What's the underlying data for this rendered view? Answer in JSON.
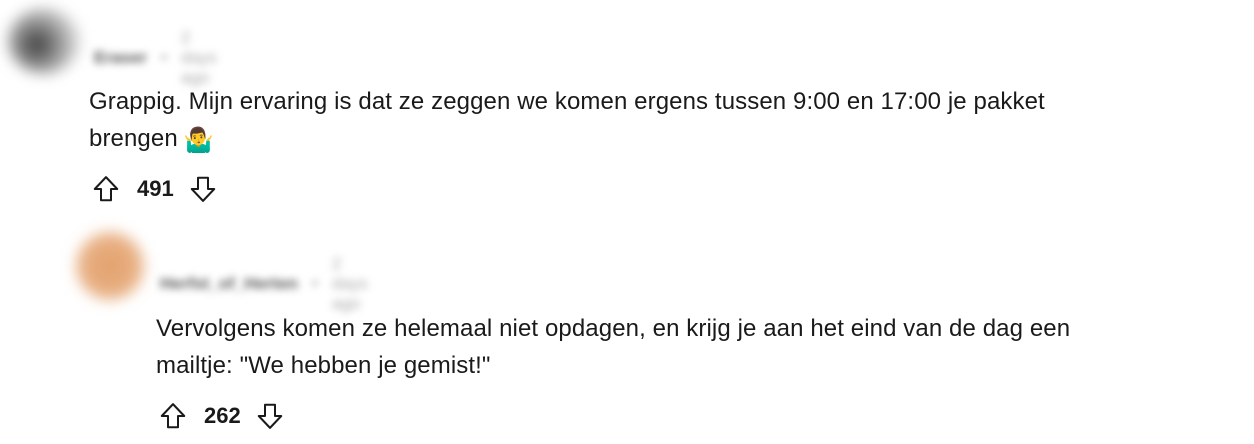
{
  "comments": [
    {
      "username": "Eraser",
      "time": "2 days ago",
      "text_lines": [
        "Grappig. Mijn ervaring is dat ze zeggen we komen ergens tussen 9:00 en 17:00 je pakket",
        "brengen"
      ],
      "emoji": "🤷‍♂️",
      "score": "491"
    },
    {
      "username": "Herfst_of_Herten",
      "time": "2 days ago",
      "text_lines": [
        "Vervolgens komen ze helemaal niet opdagen, en krijg je aan het eind van de dag een",
        "mailtje: \"We hebben je gemist!\""
      ],
      "score": "262"
    }
  ],
  "icons": {
    "upvote": "arrow-up-outline-icon",
    "downvote": "arrow-down-outline-icon"
  }
}
